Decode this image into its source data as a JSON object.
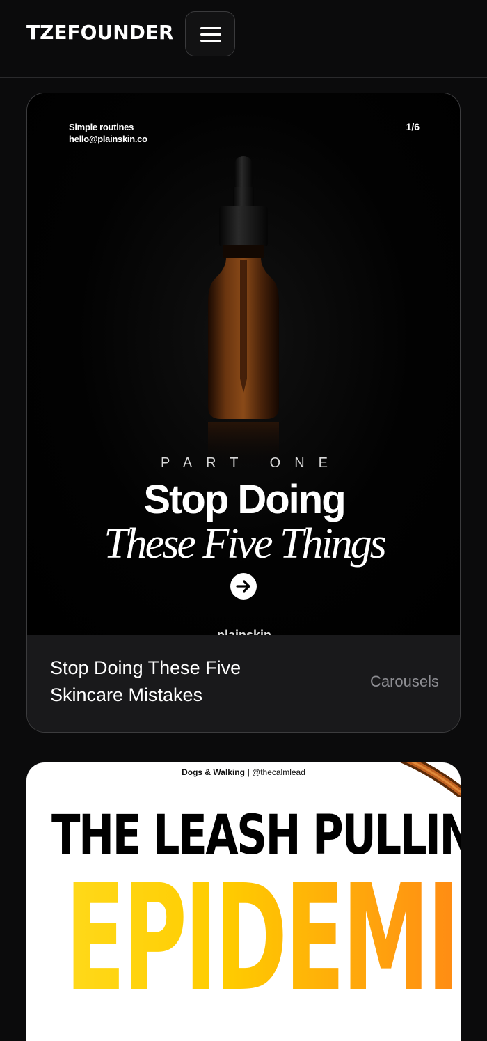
{
  "header": {
    "brand": "TZEFOUNDER",
    "menu_icon": "hamburger-menu-icon"
  },
  "card1": {
    "slide": {
      "meta_line1": "Simple routines",
      "meta_line2": "hello@plainskin.co",
      "counter": "1/6",
      "kicker": "PART ONE",
      "headline": "Stop Doing",
      "subheadline": "These Five Things",
      "arrow_icon": "arrow-right-icon",
      "brand_peek": "plainskin"
    },
    "title": "Stop Doing These Five Skincare Mistakes",
    "category": "Carousels"
  },
  "card2": {
    "meta_topic": "Dogs & Walking",
    "meta_sep": "|",
    "meta_handle": "@thecalmlead",
    "line1": "THE LEASH PULLING",
    "line2": "EPIDEMIC"
  },
  "colors": {
    "background": "#0b0b0c",
    "card_footer": "#19191b",
    "category_text": "#8e8e93",
    "accent_yellow": "#ffd91a",
    "accent_orange": "#ff7a18"
  }
}
